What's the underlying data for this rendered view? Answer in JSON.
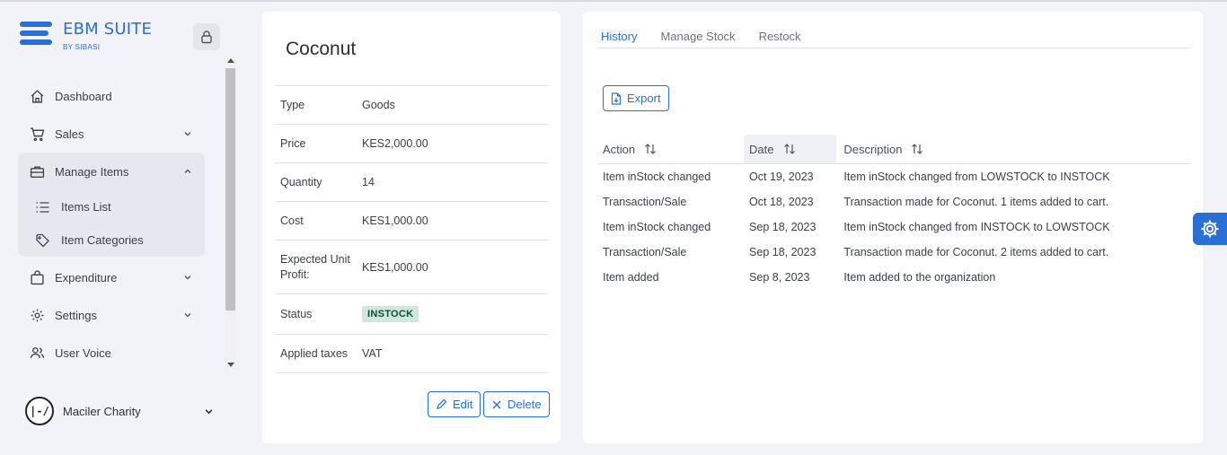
{
  "brand": {
    "title": "EBM SUITE",
    "subtitle": "BY SIBASI"
  },
  "sidebar": {
    "items": [
      {
        "label": "Dashboard",
        "icon": "home-icon"
      },
      {
        "label": "Sales",
        "icon": "cart-icon"
      },
      {
        "label": "Manage Items",
        "icon": "briefcase-icon",
        "children": [
          {
            "label": "Items List",
            "icon": "list-icon"
          },
          {
            "label": "Item Categories",
            "icon": "tag-icon"
          }
        ]
      },
      {
        "label": "Expenditure",
        "icon": "bag-icon"
      },
      {
        "label": "Settings",
        "icon": "gear-icon"
      },
      {
        "label": "User Voice",
        "icon": "users-icon"
      }
    ]
  },
  "user": {
    "name": "Maciler Charity",
    "avatar_text": "|-/"
  },
  "item": {
    "name": "Coconut",
    "fields": [
      {
        "key": "Type",
        "value": "Goods"
      },
      {
        "key": "Price",
        "value": "KES2,000.00"
      },
      {
        "key": "Quantity",
        "value": "14"
      },
      {
        "key": "Cost",
        "value": "KES1,000.00"
      },
      {
        "key": "Expected Unit Profit:",
        "value": "KES1,000.00"
      },
      {
        "key": "Status",
        "value": "INSTOCK"
      },
      {
        "key": "Applied taxes",
        "value": "VAT"
      }
    ],
    "edit_label": "Edit",
    "delete_label": "Delete"
  },
  "history": {
    "tabs": [
      "History",
      "Manage Stock",
      "Restock"
    ],
    "active_tab": "History",
    "export_label": "Export",
    "columns": [
      "Action",
      "Date",
      "Description"
    ],
    "rows": [
      [
        "Item inStock changed",
        "Oct 19, 2023",
        "Item inStock changed from LOWSTOCK to INSTOCK"
      ],
      [
        "Transaction/Sale",
        "Oct 18, 2023",
        "Transaction made for Coconut. 1 items added to cart."
      ],
      [
        "Item inStock changed",
        "Sep 18, 2023",
        "Item inStock changed from INSTOCK to LOWSTOCK"
      ],
      [
        "Transaction/Sale",
        "Sep 18, 2023",
        "Transaction made for Coconut. 2 items added to cart."
      ],
      [
        "Item added",
        "Sep 8, 2023",
        "Item added to the organization"
      ]
    ]
  },
  "colors": {
    "accent": "#2a6fd6",
    "status_bg": "#d1e7dd",
    "status_text": "#0f5132"
  }
}
